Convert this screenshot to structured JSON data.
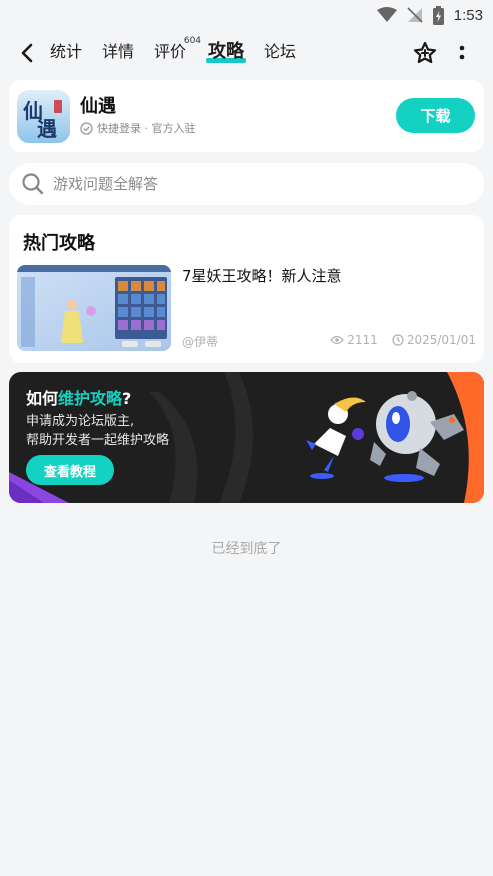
{
  "status": {
    "time": "1:53"
  },
  "nav": {
    "tabs": [
      {
        "label": "统计"
      },
      {
        "label": "详情"
      },
      {
        "label": "评价",
        "count": "604"
      },
      {
        "label": "攻略"
      },
      {
        "label": "论坛"
      }
    ]
  },
  "game": {
    "name": "仙遇",
    "subtitle": "快捷登录 · 官方入驻",
    "download_label": "下载",
    "icon_text": "仙遇"
  },
  "search": {
    "placeholder": "游戏问题全解答"
  },
  "hot": {
    "title": "热门攻略",
    "articles": [
      {
        "title": "7星妖王攻略！新人注意",
        "author": "@伊蒂",
        "views": "2111",
        "date": "2025/01/01"
      }
    ]
  },
  "banner": {
    "title_prefix": "如何",
    "title_highlight": "维护攻略",
    "title_suffix": "?",
    "line1": "申请成为论坛版主,",
    "line2": "帮助开发者一起维护攻略",
    "button_label": "查看教程"
  },
  "footer": {
    "end_text": "已经到底了"
  },
  "colors": {
    "accent": "#14d2c2",
    "banner_bg": "#1f1f1f",
    "banner_orange": "#ff6a2a",
    "banner_purple": "#8b45e0"
  }
}
